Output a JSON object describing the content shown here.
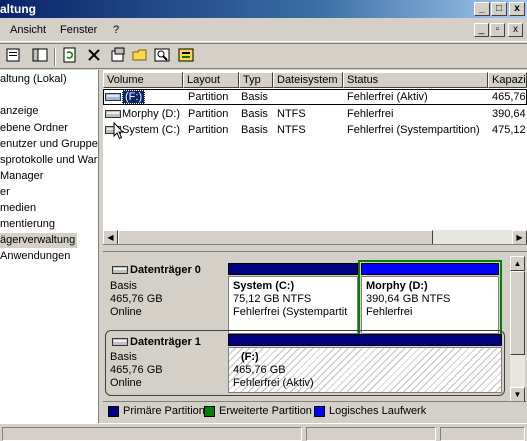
{
  "window": {
    "title": "altung",
    "buttons": [
      "_",
      "□",
      "x"
    ],
    "mdi_buttons": [
      "_",
      "▫",
      "x"
    ]
  },
  "menubar": {
    "items": [
      "Ansicht",
      "Fenster",
      "?"
    ]
  },
  "toolbar": {
    "icons": [
      "properties-icon",
      "show-hide-tree-icon",
      "refresh-icon",
      "delete-icon",
      "properties-sheet-icon",
      "open-folder-icon",
      "explore-icon",
      "help-icon"
    ]
  },
  "tree": {
    "items": [
      {
        "label": "altung (Lokal)",
        "selected": false
      },
      {
        "label": "anzeige",
        "selected": false
      },
      {
        "label": "ebene Ordner",
        "selected": false
      },
      {
        "label": "enutzer und Gruppe",
        "selected": false
      },
      {
        "label": "sprotokolle und War",
        "selected": false
      },
      {
        "label": "Manager",
        "selected": false
      },
      {
        "label": "er",
        "selected": false
      },
      {
        "label": "medien",
        "selected": false
      },
      {
        "label": "mentierung",
        "selected": false
      },
      {
        "label": "ägerverwaltung",
        "selected": true
      },
      {
        "label": "Anwendungen",
        "selected": false
      }
    ]
  },
  "volume_list": {
    "columns": [
      "Volume",
      "Layout",
      "Typ",
      "Dateisystem",
      "Status",
      "Kapazi"
    ],
    "rows": [
      {
        "volume": "(F:)",
        "layout": "Partition",
        "typ": "Basis",
        "dateisystem": "",
        "status": "Fehlerfrei (Aktiv)",
        "kapazitaet": "465,76"
      },
      {
        "volume": "Morphy (D:)",
        "layout": "Partition",
        "typ": "Basis",
        "dateisystem": "NTFS",
        "status": "Fehlerfrei",
        "kapazitaet": "390,64"
      },
      {
        "volume": "System (C:)",
        "layout": "Partition",
        "typ": "Basis",
        "dateisystem": "NTFS",
        "status": "Fehlerfrei (Systempartition)",
        "kapazitaet": "475,12 G"
      }
    ]
  },
  "disks": [
    {
      "name": "Datenträger 0",
      "type": "Basis",
      "size": "465,76 GB",
      "state": "Online",
      "partitions": [
        {
          "name": "System  (C:)",
          "size": "75,12 GB NTFS",
          "status": "Fehlerfrei (Systempartit",
          "bar_color": "#000080"
        },
        {
          "name": "Morphy  (D:)",
          "size": "390,64 GB NTFS",
          "status": "Fehlerfrei",
          "bar_color": "#0000ff"
        }
      ]
    },
    {
      "name": "Datenträger 1",
      "type": "Basis",
      "size": "465,76 GB",
      "state": "Online",
      "partitions": [
        {
          "name": "(F:)",
          "size": "465,76 GB",
          "status": "Fehlerfrei (Aktiv)",
          "bar_color": "#000080"
        }
      ]
    }
  ],
  "legend": [
    {
      "label": "Primäre Partition",
      "color": "#000080"
    },
    {
      "label": "Erweiterte Partition",
      "color": "#008000"
    },
    {
      "label": "Logisches Laufwerk",
      "color": "#0000ff"
    }
  ]
}
